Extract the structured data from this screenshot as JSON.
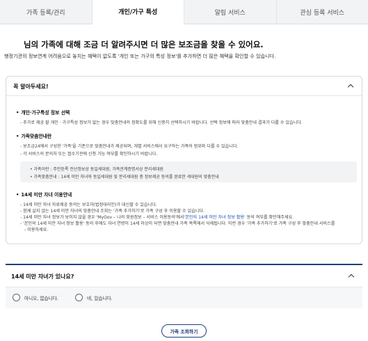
{
  "tabs": [
    {
      "label": "가족 등록/관리"
    },
    {
      "label": "개인/가구 특성"
    },
    {
      "label": "알림 서비스"
    },
    {
      "label": "관심 등록 서비스"
    }
  ],
  "intro": {
    "headline": "님의 가족에 대해 조금 더 알려주시면 더 많은 보조금을 찾을 수 있어요.",
    "subline": "행정기관의 정보연계 어려움으로 놓치는 혜택이 없도록 '개인 또는 가구의 특성 정보'를 추가하면 더 많은 혜택을 확인할 수 있습니다."
  },
  "notice": {
    "title": "꼭 알아두세요!",
    "sections": [
      {
        "title": "개인·가구특성 정보 선택",
        "items": [
          "추가로 제공 할 개인 · 가구특성 정보가 없는 경우 맞춤안내의 정확도를 위해 신중히 선택하시기 바랍니다. 선택 정보에 따라 맞춤안내 결과가 다를 수 있습니다."
        ]
      },
      {
        "title": "가족맞춤안내란",
        "items": [
          "보조금24에서 구성한 '가족'을 기준으로 맞춤안내가 제공되며, 개별 서비스에서 요구하는 가족의 범위와 다를 수 있습니다.",
          "각 서비스의 문의처 또는 접수기관에 신청 가능 여부를 확인하시기 바랍니다."
        ],
        "box": [
          "가족이란 : 주민등록 전산정보상 동일세대원, 가족관계증명서상 분리세대원",
          "가족맞춤안내 : 14세 미만 자녀와 동일세대원 및 분리세대원 중 정보제공 동의를 완료한 세대원의 맞춤안내"
        ]
      },
      {
        "title": "14세 미만 자녀 이용안내",
        "items": [
          "14세 미만 자녀 자료제공 동의는 보호자(법정대리인)가 대신할 수 있습니다.",
          "함께 살지 않는 14세 미만 자녀의 맞춤안내 조회는 '가족 추가하기'로 가족 구성 후 이용할 수 있습니다.",
          "14세 미만 자녀 정보가 보이지 않을 경우 'MyGov – 나의 회원정보 – 서비스 이용동의'에서",
          "'본인의 14세 미만 자녀 정보 활용' 동의 후에도 자녀 연령이 14세 이상이 되면 맞춤안내 가족 목록에서 삭제됩니다. 이런 경우 '가족 추가하기'로 가족 구성 후 맞춤안내 서비스를",
          "이용하세요."
        ],
        "link_14": "'본인의 14세 미만 자녀 정보 활용'",
        "link_14_tail": " 동의 여부를 확인해주세요.",
        "blue_phrase": "자녀 연령이 14세 이상이 되면 맞춤안내 가족 목록에서 삭제"
      }
    ]
  },
  "question": {
    "title": "14세 미만 자녀가 있나요?",
    "options": [
      "아니오, 없습니다.",
      "네, 있습니다."
    ]
  },
  "submit_label": "가족 조회하기"
}
